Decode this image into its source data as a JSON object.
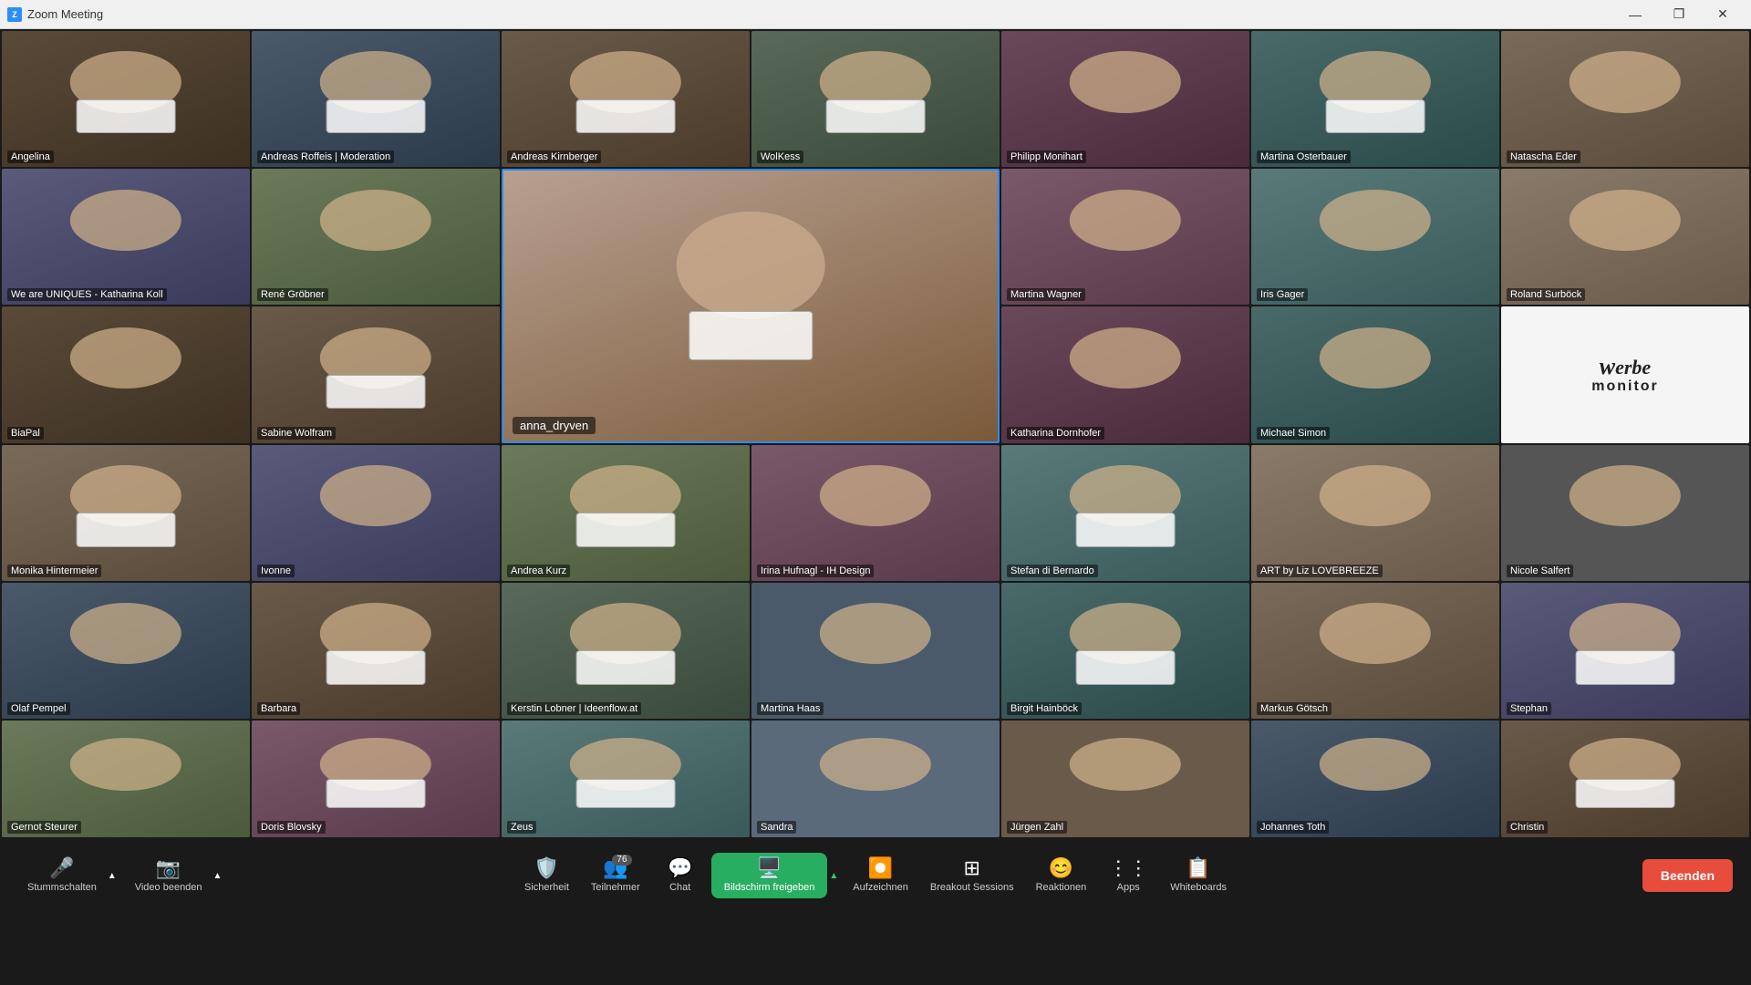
{
  "window": {
    "title": "Zoom Meeting",
    "controls": {
      "minimize": "—",
      "restore": "❐",
      "close": "✕"
    }
  },
  "participants": [
    {
      "id": 1,
      "name": "Angelina",
      "colorClass": "p1",
      "micMuted": true
    },
    {
      "id": 2,
      "name": "Andreas Roffeis | Moderation",
      "colorClass": "p2",
      "micMuted": false
    },
    {
      "id": 3,
      "name": "Andreas Kirnberger",
      "colorClass": "p3",
      "micMuted": true
    },
    {
      "id": 4,
      "name": "WolKess",
      "colorClass": "p4",
      "micMuted": true
    },
    {
      "id": 5,
      "name": "Philipp Monihart",
      "colorClass": "p5",
      "micMuted": true
    },
    {
      "id": 6,
      "name": "Martina Osterbauer",
      "colorClass": "p6",
      "micMuted": true
    },
    {
      "id": 7,
      "name": "Natascha Eder",
      "colorClass": "p7",
      "micMuted": true
    },
    {
      "id": 8,
      "name": "We are UNIQUES - Katharina Koll",
      "colorClass": "p8",
      "micMuted": true
    },
    {
      "id": 9,
      "name": "René Gröbner",
      "colorClass": "p9",
      "micMuted": true
    },
    {
      "id": 10,
      "name": "Martina Wagner",
      "colorClass": "p10",
      "micMuted": true
    },
    {
      "id": 11,
      "name": "Iris Gager",
      "colorClass": "p11",
      "micMuted": true
    },
    {
      "id": 12,
      "name": "Roland Surböck",
      "colorClass": "p12",
      "micMuted": true
    },
    {
      "id": 13,
      "name": "BiaPal",
      "colorClass": "p1",
      "micMuted": true
    },
    {
      "id": 14,
      "name": "Sabine Wolfram",
      "colorClass": "p3",
      "micMuted": true
    },
    {
      "id": 15,
      "name": "anna_dryven",
      "colorClass": "active",
      "micMuted": false,
      "activeSpeaker": true
    },
    {
      "id": 16,
      "name": "Katharina Dornhofer",
      "colorClass": "p5",
      "micMuted": true
    },
    {
      "id": 17,
      "name": "Michael Simon",
      "colorClass": "p6",
      "micMuted": true
    },
    {
      "id": 18,
      "name": "werbe_monitor_logo",
      "isLogo": true
    },
    {
      "id": 19,
      "name": "Monika Hintermeier",
      "colorClass": "p7",
      "micMuted": true
    },
    {
      "id": 20,
      "name": "Ivonne",
      "colorClass": "p8",
      "micMuted": true
    },
    {
      "id": 21,
      "name": "Andrea Kurz",
      "colorClass": "p9",
      "micMuted": true
    },
    {
      "id": 22,
      "name": "Irina Hufnagl - IH Design",
      "colorClass": "p10",
      "micMuted": true
    },
    {
      "id": 23,
      "name": "Stefan di Bernardo",
      "colorClass": "p11",
      "micMuted": true
    },
    {
      "id": 24,
      "name": "ART by Liz LOVEBREEZE",
      "colorClass": "p12",
      "micMuted": true
    },
    {
      "id": 25,
      "name": "Nicole Salfert",
      "colorClass": "p1",
      "micMuted": true
    },
    {
      "id": 26,
      "name": "Olaf Pempel",
      "colorClass": "p2",
      "micMuted": true
    },
    {
      "id": 27,
      "name": "Barbara",
      "colorClass": "p3",
      "micMuted": true
    },
    {
      "id": 28,
      "name": "Kerstin Lobner | Ideenflow.at",
      "colorClass": "p4",
      "micMuted": true
    },
    {
      "id": 29,
      "name": "Martina Haas",
      "colorClass": "p5",
      "micMuted": true
    },
    {
      "id": 30,
      "name": "Birgit Hainböck",
      "colorClass": "p6",
      "micMuted": true
    },
    {
      "id": 31,
      "name": "Markus Götsch",
      "colorClass": "p7",
      "micMuted": true
    },
    {
      "id": 32,
      "name": "Stephan",
      "colorClass": "p8",
      "micMuted": true
    },
    {
      "id": 33,
      "name": "Gernot Steurer",
      "colorClass": "p9",
      "micMuted": true
    },
    {
      "id": 34,
      "name": "Doris Blovsky",
      "colorClass": "p10",
      "micMuted": true
    },
    {
      "id": 35,
      "name": "Zeus",
      "colorClass": "p11",
      "micMuted": true
    },
    {
      "id": 36,
      "name": "Sandra",
      "colorClass": "p12",
      "micMuted": true
    },
    {
      "id": 37,
      "name": "Jürgen Zahl",
      "colorClass": "p1",
      "micMuted": true
    },
    {
      "id": 38,
      "name": "Johannes Toth",
      "colorClass": "p2",
      "micMuted": true
    },
    {
      "id": 39,
      "name": "Christin",
      "colorClass": "p3",
      "micMuted": true
    }
  ],
  "toolbar": {
    "muteBtnLabel": "Stummschalten",
    "videoBtnLabel": "Video beenden",
    "securityLabel": "Sicherheit",
    "participantsLabel": "Teilnehmer",
    "participantCount": "76",
    "chatLabel": "Chat",
    "shareLabel": "Bildschirm freigeben",
    "recordLabel": "Aufzeichnen",
    "breakoutLabel": "Breakout Sessions",
    "reactionsLabel": "Reaktionen",
    "appsLabel": "Apps",
    "whiteboardsLabel": "Whiteboards",
    "endBtnLabel": "Beenden"
  }
}
